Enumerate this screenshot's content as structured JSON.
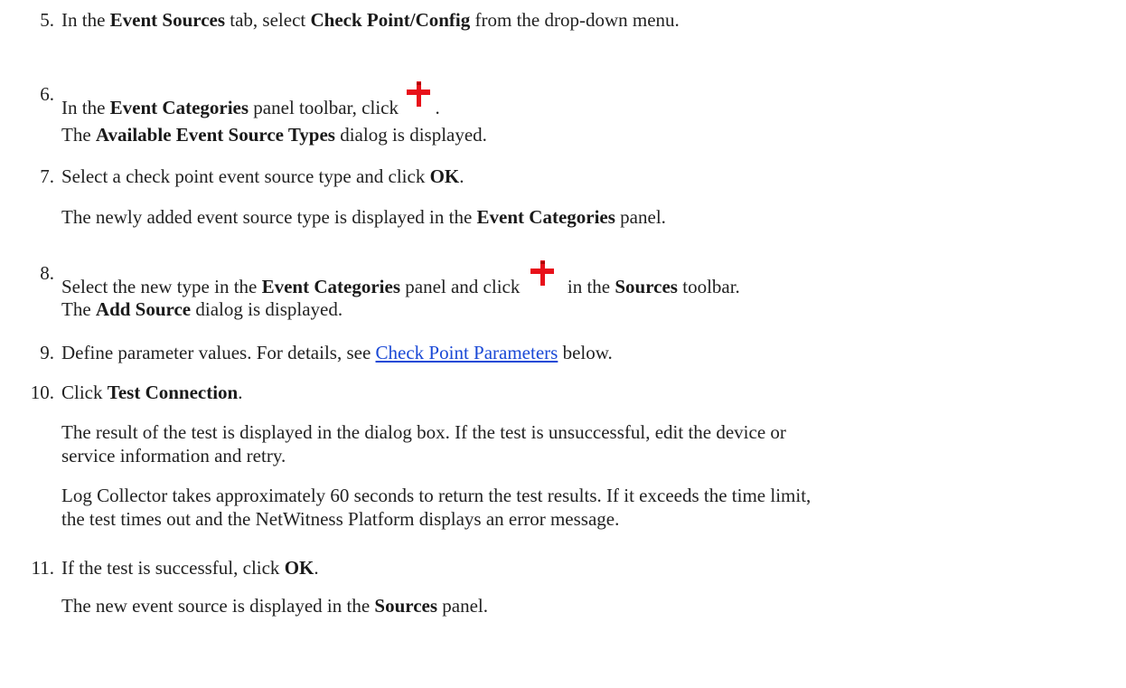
{
  "steps": [
    {
      "num": "5.",
      "pre": "In the ",
      "b1": "Event Sources",
      "mid": " tab, select ",
      "b2": "Check Point/Config",
      "post": " from the drop-down menu."
    },
    {
      "num": "6.",
      "pre": "In the ",
      "b1": "Event Categories",
      "post": " panel toolbar, click",
      "after_icon": ".",
      "result_pre": "The ",
      "result_b": "Available Event Source Types",
      "result_post": " dialog is displayed."
    },
    {
      "num": "7.",
      "pre": "Select a check point event source type and click ",
      "b1": "OK",
      "post": ".",
      "result_pre": "The newly added event source type is displayed in the ",
      "result_b": "Event Categories",
      "result_post": " panel."
    },
    {
      "num": "8.",
      "pre": "Select the new type in the ",
      "b1": "Event Categories",
      "mid": " panel and click",
      "mid2": " in the ",
      "b2": "Sources",
      "post": " toolbar.",
      "result_pre": "The ",
      "result_b": "Add Source",
      "result_post": " dialog is displayed."
    },
    {
      "num": "9.",
      "pre": "Define parameter values. For details, see ",
      "link": "Check Point Parameters",
      "post": " below."
    },
    {
      "num": "10.",
      "pre": "Click ",
      "b1": "Test Connection",
      "post": ".",
      "para1_l1": "The result of the test is displayed in the dialog box. If the test is unsuccessful, edit the device or",
      "para1_l2": "service information and retry.",
      "para2_l1": "Log Collector takes approximately 60 seconds to return the test results. If it exceeds the time limit,",
      "para2_l2": "the test times out and the NetWitness Platform displays an error message."
    },
    {
      "num": "11.",
      "pre": "If the test is successful, click ",
      "b1": "OK",
      "post": ".",
      "result_pre": "The new event source is displayed in the ",
      "result_b": "Sources",
      "result_post": " panel."
    }
  ],
  "icons": {
    "add": "plus-icon",
    "add_color": "#e8101a"
  }
}
